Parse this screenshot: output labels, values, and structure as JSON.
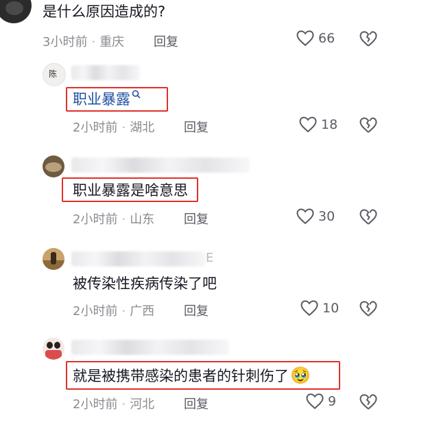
{
  "comments": [
    {
      "text": "是什么原因造成的?",
      "time": "3小时前",
      "location": "重庆",
      "reply": "回复",
      "likes": "66"
    },
    {
      "text": "职业暴露",
      "time": "2小时前",
      "location": "湖北",
      "reply": "回复",
      "likes": "18"
    },
    {
      "text": "职业暴露是啥意思",
      "time": "2小时前",
      "location": "山东",
      "reply": "回复",
      "likes": "30"
    },
    {
      "name_tail": "E",
      "text": "被传染性疾病传染了吧",
      "time": "2小时前",
      "location": "广西",
      "reply": "回复",
      "likes": "10"
    },
    {
      "text": "就是被携带感染的患者的针刺伤了",
      "emoji": "🥹",
      "time": "2小时前",
      "location": "河北",
      "reply": "回复",
      "likes": "9"
    }
  ],
  "avatar_badge": "陈",
  "colors": {
    "highlight_border": "#e0302a",
    "link_blue": "#1f4fa0",
    "meta_gray": "#8a8b91"
  }
}
